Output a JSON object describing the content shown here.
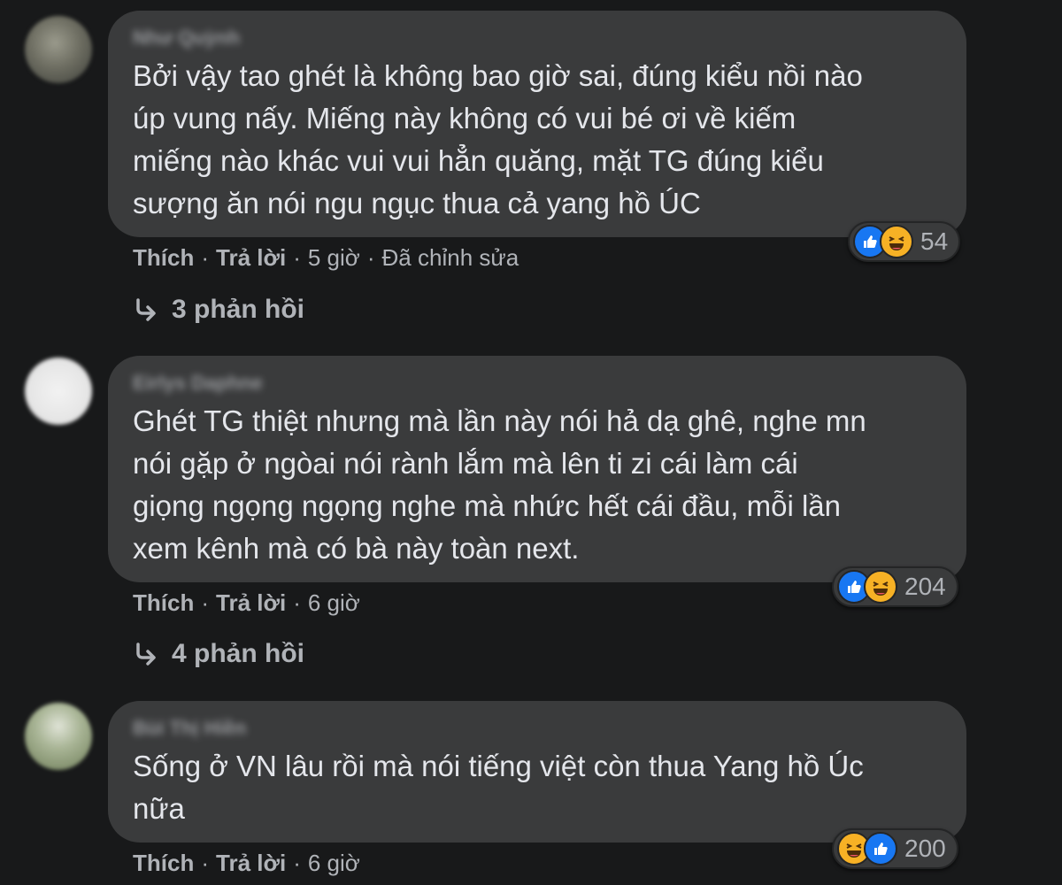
{
  "comments": [
    {
      "author": "Như Quỳnh",
      "text": "Bởi vậy tao ghét là không bao giờ sai, đúng kiểu nồi nào\núp vung nấy. Miếng này không có vui bé ơi về kiếm\nmiếng nào khác vui vui hẳn quăng, mặt TG đúng kiểu\nsượng ăn nói ngu ngục thua cả yang hồ ÚC",
      "reaction_count": "54",
      "reaction_icons": [
        "like-icon",
        "haha-icon"
      ],
      "like_label": "Thích",
      "reply_label": "Trả lời",
      "time": "5 giờ",
      "edited": "Đã chỉnh sửa",
      "replies": "3 phản hồi"
    },
    {
      "author": "Eirlys Daphne",
      "text": "Ghét TG thiệt nhưng mà lần này nói hả dạ ghê, nghe mn\nnói gặp ở ngòai nói rành lắm mà lên ti zi cái làm cái\ngiọng ngọng ngọng nghe mà nhức hết cái đầu, mỗi lần\nxem kênh mà có bà này toàn next.",
      "reaction_count": "204",
      "reaction_icons": [
        "like-icon",
        "haha-icon"
      ],
      "like_label": "Thích",
      "reply_label": "Trả lời",
      "time": "6 giờ",
      "replies": "4 phản hồi"
    },
    {
      "author": "Bùi Thị Hiền",
      "text": "Sống ở VN lâu rồi mà nói tiếng việt còn thua Yang hồ Úc\nnữa",
      "reaction_count": "200",
      "reaction_icons": [
        "haha-icon",
        "like-icon"
      ],
      "like_label": "Thích",
      "reply_label": "Trả lời",
      "time": "6 giờ"
    }
  ],
  "separator": "·",
  "colors": {
    "background": "#18191a",
    "bubble": "#3a3b3c",
    "text": "#e4e6eb",
    "secondary_text": "#b0b3b8",
    "like_blue": "#1877f2",
    "haha_yellow": "#f7b125"
  }
}
